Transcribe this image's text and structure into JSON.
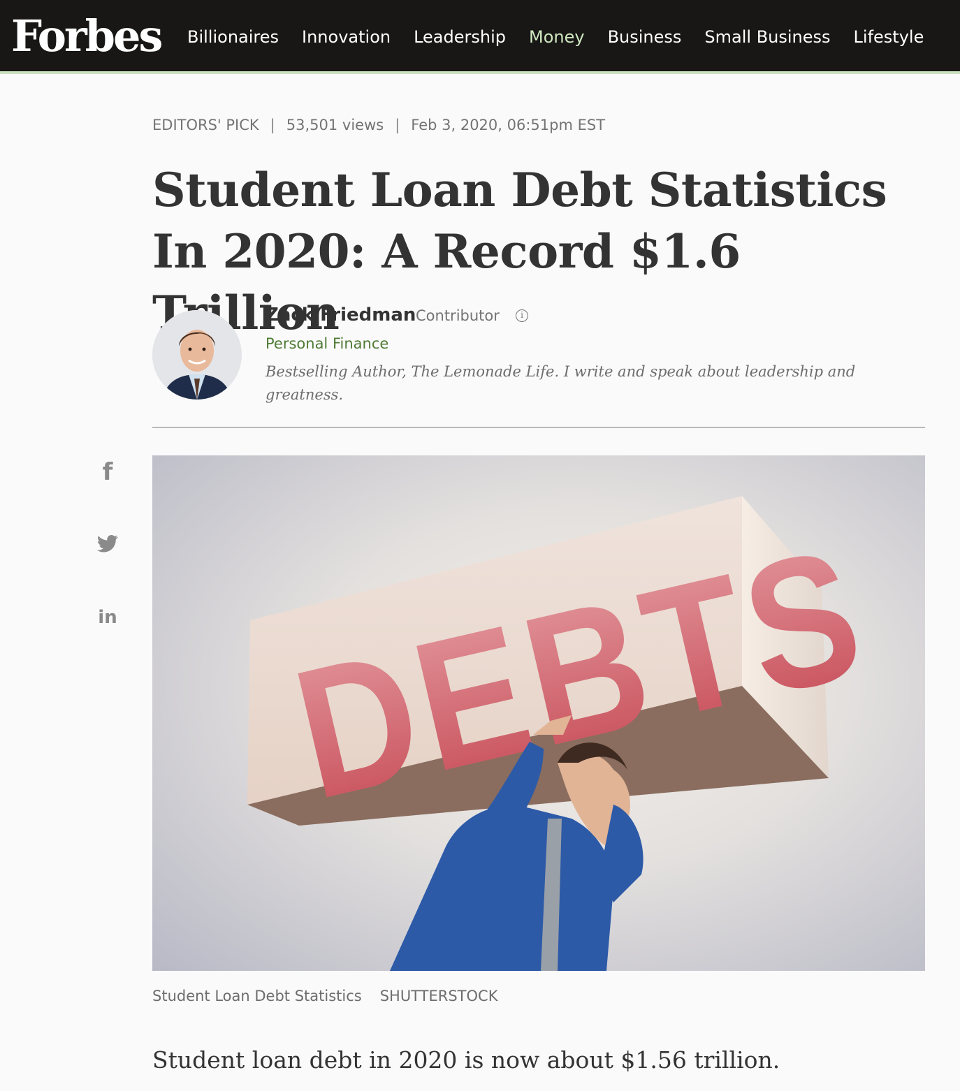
{
  "header": {
    "logo": "Forbes",
    "nav": [
      {
        "label": "Billionaires",
        "active": false
      },
      {
        "label": "Innovation",
        "active": false
      },
      {
        "label": "Leadership",
        "active": false
      },
      {
        "label": "Money",
        "active": true
      },
      {
        "label": "Business",
        "active": false
      },
      {
        "label": "Small Business",
        "active": false
      },
      {
        "label": "Lifestyle",
        "active": false
      }
    ],
    "background": "#181716",
    "active_color": "#cfe8c0"
  },
  "meta": {
    "tag": "EDITORS' PICK",
    "views": "53,501 views",
    "date": "Feb 3, 2020, 06:51pm EST"
  },
  "headline": "Student Loan Debt Statistics In 2020: A Record $1.6 Trillion",
  "author": {
    "name": "Zack Friedman",
    "role": "Contributor",
    "info_icon": "info-icon",
    "section": "Personal Finance",
    "bio": "Bestselling Author, The Lemonade Life. I write and speak about leadership and greatness."
  },
  "share": {
    "icons": [
      "facebook-icon",
      "twitter-icon",
      "linkedin-icon"
    ]
  },
  "hero": {
    "box_text": "DEBTS",
    "caption": "Student Loan Debt Statistics",
    "credit": "Shutterstock"
  },
  "lead": "Student loan debt in 2020 is now about $1.56 trillion.",
  "colors": {
    "section_green": "#4f7a35",
    "debts_red": "#c64a55"
  }
}
